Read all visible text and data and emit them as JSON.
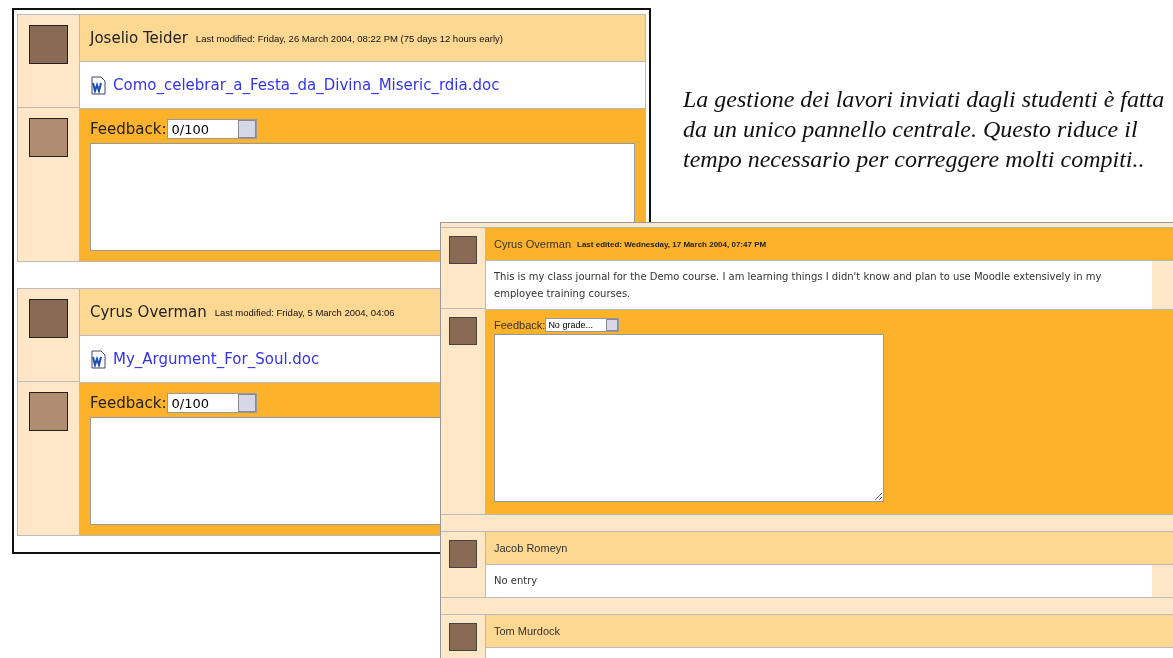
{
  "submissions": [
    {
      "student": "Joselio Teider",
      "modified": "Last modified: Friday, 26 March 2004, 08:22 PM (75 days 12 hours early)",
      "file": "Como_celebrar_a_Festa_da_Divina_Miseric_rdia.doc",
      "feedback_label": "Feedback:",
      "grade": "0/100"
    },
    {
      "student": "Cyrus Overman",
      "modified": "Last modified: Friday, 5 March 2004, 04:06",
      "file": "My_Argument_For_Soul.doc",
      "feedback_label": "Feedback:",
      "grade": "0/100"
    }
  ],
  "caption": "La gestione dei lavori inviati dagli studenti è fatta da un unico pannello centrale. Questo riduce il tempo necessario per correggere molti compiti..",
  "journal": {
    "entries": [
      {
        "kind": "entry",
        "student": "Cyrus Overman",
        "edited": "Last edited: Wednesday, 17 March 2004, 07:47 PM",
        "text": "This is my class journal for the Demo course. I am learning things I didn't know and plan to use Moodle extensively in my employee training courses.",
        "feedback_label": "Feedback:",
        "grade": "No grade..."
      },
      {
        "kind": "empty",
        "student": "Jacob Romeyn",
        "text": "No entry"
      },
      {
        "kind": "cut",
        "student": "Tom Murdock"
      }
    ]
  }
}
